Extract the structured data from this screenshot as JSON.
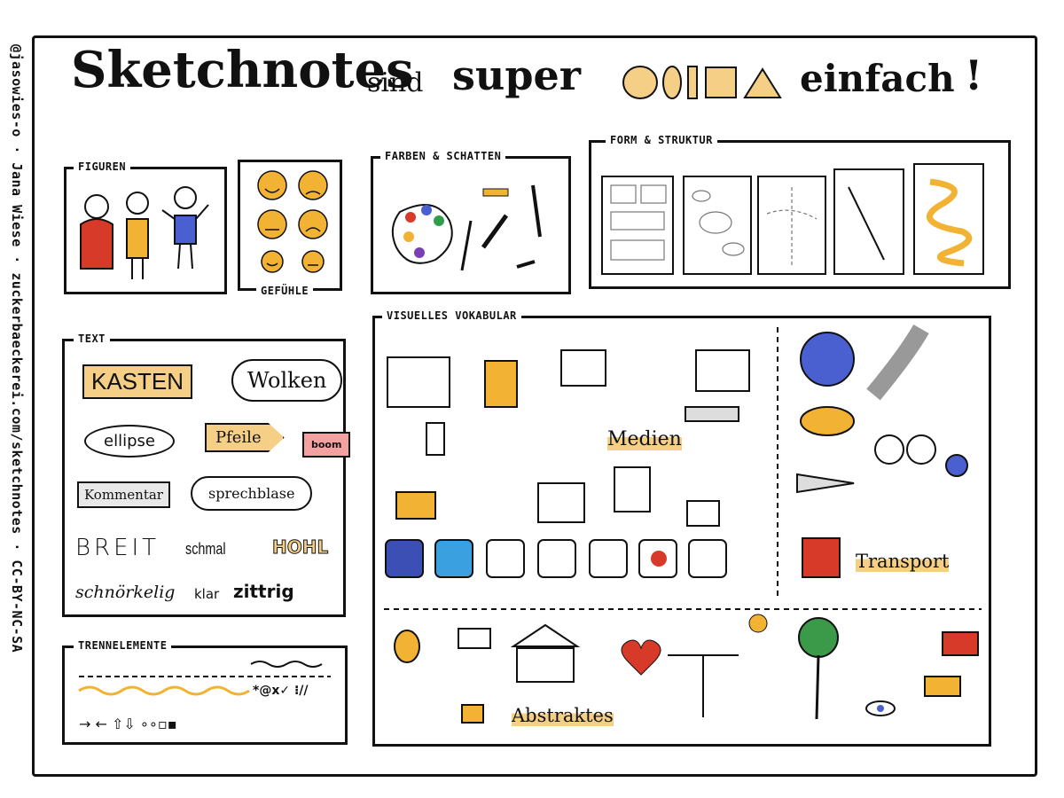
{
  "sidebar_text": "@jasowies-o · Jana Wiese · zuckerbaeckerei.com/sketchnotes · CC-BY-NC-SA",
  "title": {
    "w1": "Sketchnotes",
    "w2": "sind",
    "w3": "super",
    "w4": "einfach",
    "bang": "!"
  },
  "panels": {
    "figuren": "FIGUREN",
    "gefuehle": "GEFÜHLE",
    "farben": "FARBEN & SCHATTEN",
    "form": "FORM & STRUKTUR",
    "text": "TEXT",
    "vokabular": "VISUELLES VOKABULAR",
    "trenn": "TRENNELEMENTE"
  },
  "text_panel": {
    "kasten": "KASTEN",
    "wolken": "Wolken",
    "ellipse": "ellipse",
    "pfeile": "Pfeile",
    "boom": "boom",
    "kommentar": "Kommentar",
    "sprechblase": "sprechblase",
    "breit": "BREIT",
    "schmal": "schmal",
    "hohl": "HOHL",
    "schnoerkelig": "schnörkelig",
    "klar": "klar",
    "zittrig": "zittrig"
  },
  "vocab_labels": {
    "medien": "Medien",
    "transport": "Transport",
    "abstraktes": "Abstraktes"
  },
  "trenn": {
    "symbols": "*@x✓ ⁝//",
    "arrows": "→ ←  ⇧⇩ ∘∘▫▪"
  },
  "colors": {
    "accent_orange": "#f2b233",
    "shadow_gray": "#cfcfcf",
    "red": "#d83a2a",
    "blue": "#4a5fd0",
    "fb": "#3b4fb5",
    "tw": "#3aa0e0"
  }
}
